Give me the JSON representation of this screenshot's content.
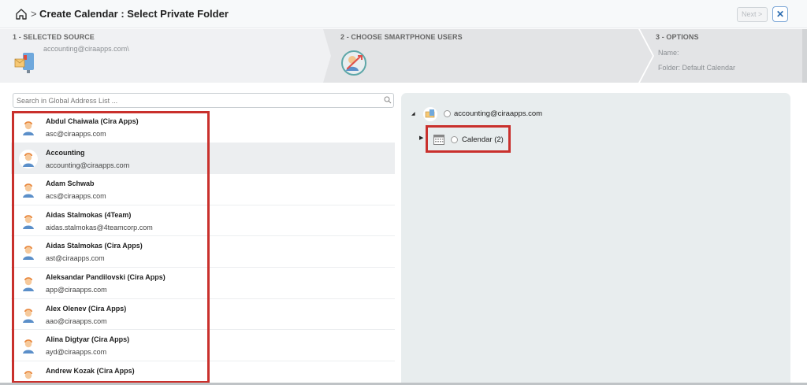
{
  "header": {
    "breadcrumb_separator": ">",
    "title": "Create Calendar  :  Select Private Folder",
    "next_label": "Next >",
    "close_label": "✕"
  },
  "steps": [
    {
      "label": "1 - SELECTED SOURCE",
      "value": "accounting@ciraapps.com\\"
    },
    {
      "label": "2 - CHOOSE SMARTPHONE USERS"
    },
    {
      "label": "3 - OPTIONS",
      "name_label": "Name:",
      "folder_label": "Folder: Default Calendar"
    }
  ],
  "search": {
    "placeholder": "Search in Global Address List ..."
  },
  "contacts": [
    {
      "name": "Abdul Chaiwala (Cira Apps)",
      "email": "asc@ciraapps.com"
    },
    {
      "name": "Accounting",
      "email": "accounting@ciraapps.com"
    },
    {
      "name": "Adam Schwab",
      "email": "acs@ciraapps.com"
    },
    {
      "name": "Aidas Stalmokas (4Team)",
      "email": "aidas.stalmokas@4teamcorp.com"
    },
    {
      "name": "Aidas Stalmokas (Cira Apps)",
      "email": "ast@ciraapps.com"
    },
    {
      "name": "Aleksandar Pandilovski (Cira Apps)",
      "email": "app@ciraapps.com"
    },
    {
      "name": "Alex Olenev (Cira Apps)",
      "email": "aao@ciraapps.com"
    },
    {
      "name": "Alina Digtyar (Cira Apps)",
      "email": "ayd@ciraapps.com"
    },
    {
      "name": "Andrew Kozak (Cira Apps)",
      "email": ""
    }
  ],
  "tree": {
    "root_label": "accounting@ciraapps.com",
    "child_label": "Calendar (2)"
  },
  "colors": {
    "highlight": "#c9302c",
    "panel_bg": "#e8edee",
    "selected_row": "#eceef0"
  }
}
